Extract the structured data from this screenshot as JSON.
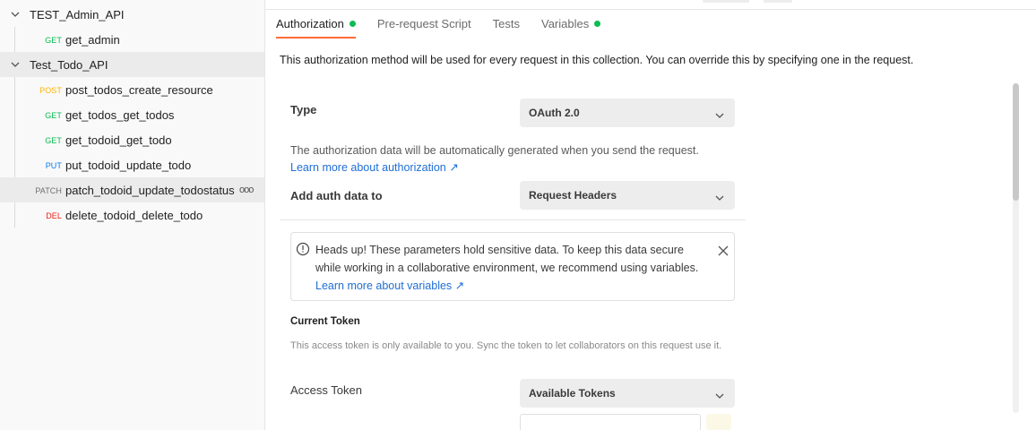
{
  "sidebar": {
    "folders": [
      {
        "name": "TEST_Admin_API"
      },
      {
        "name": "Test_Todo_API"
      }
    ],
    "requests": [
      {
        "method": "GET",
        "name": "get_admin"
      },
      {
        "method": "POST",
        "name": "post_todos_create_resource"
      },
      {
        "method": "GET",
        "name": "get_todos_get_todos"
      },
      {
        "method": "GET",
        "name": "get_todoid_get_todo"
      },
      {
        "method": "PUT",
        "name": "put_todoid_update_todo"
      },
      {
        "method": "PATCH",
        "name": "patch_todoid_update_todostatus",
        "more": "ooo"
      },
      {
        "method": "DEL",
        "name": "delete_todoid_delete_todo"
      }
    ]
  },
  "tabs": [
    {
      "label": "Authorization",
      "active": true,
      "dot": true
    },
    {
      "label": "Pre-request Script",
      "active": false,
      "dot": false
    },
    {
      "label": "Tests",
      "active": false,
      "dot": false
    },
    {
      "label": "Variables",
      "active": false,
      "dot": true
    }
  ],
  "auth": {
    "description": "This authorization method will be used for every request in this collection. You can override this by specifying one in the request.",
    "type_label": "Type",
    "type_value": "OAuth 2.0",
    "generated_note": "The authorization data will be automatically generated when you send the request.",
    "learn_auth_link": "Learn more about authorization ↗",
    "add_auth_label": "Add auth data to",
    "add_auth_value": "Request Headers",
    "notice_text": "Heads up! These parameters hold sensitive data. To keep this data secure while working in a collaborative environment, we recommend using variables.",
    "notice_link": "Learn more about variables ↗",
    "current_token_title": "Current Token",
    "token_note": "This access token is only available to you. Sync the token to let collaborators on this request use it.",
    "access_token_label": "Access Token",
    "access_token_value": "Available Tokens"
  },
  "colors": {
    "accent": "#ff6c37",
    "success": "#0cbb52",
    "link": "#1f6ed4"
  }
}
